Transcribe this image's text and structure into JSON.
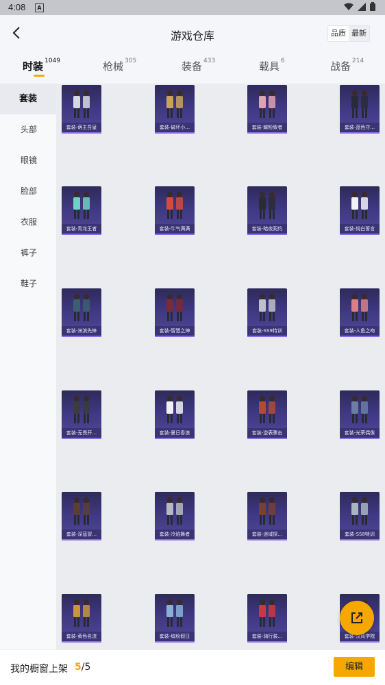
{
  "status": {
    "time": "4:08",
    "notif_icon": "A"
  },
  "header": {
    "title": "游戏仓库",
    "sort_options": [
      "品质",
      "最新"
    ],
    "sort_active": 0
  },
  "tabs": [
    {
      "label": "时装",
      "count": "1049",
      "active": true
    },
    {
      "label": "枪械",
      "count": "305",
      "active": false
    },
    {
      "label": "装备",
      "count": "433",
      "active": false
    },
    {
      "label": "载具",
      "count": "6",
      "active": false
    },
    {
      "label": "战备",
      "count": "214",
      "active": false
    }
  ],
  "sidebar": {
    "items": [
      "套装",
      "头部",
      "眼镜",
      "脸部",
      "衣服",
      "裤子",
      "鞋子"
    ],
    "active": 0
  },
  "items": [
    "套装-萌主吾皇",
    "套装-破坏小...",
    "套装-耀粉致者",
    "套装-蓝色守...",
    "套装-青龙王者",
    "套装-牛气满满",
    "套装-暗夜契约",
    "套装-纯白誓言",
    "套装-洲滨先锋",
    "套装-智慧之神",
    "套装-SS9特训",
    "套装-人鱼之吻",
    "套装-无畏开...",
    "套装-夏日香浪",
    "套装-逆表骤击",
    "套装-光荣偶像",
    "套装-深蓝冒...",
    "套装-冷焰舞者",
    "套装-迷域探...",
    "套装-SS8特训",
    "套装-黄色名流",
    "套装-缤纷假日",
    "套装-骑行装...",
    "套装-汉风学院"
  ],
  "bottom": {
    "label": "我的橱窗上架",
    "current": "5",
    "sep": "/",
    "total": "5",
    "edit_label": "编辑"
  },
  "colors": {
    "accent": "#f7a800",
    "card_bg": "#3e3780",
    "card_stripe": "#8c6be8"
  }
}
